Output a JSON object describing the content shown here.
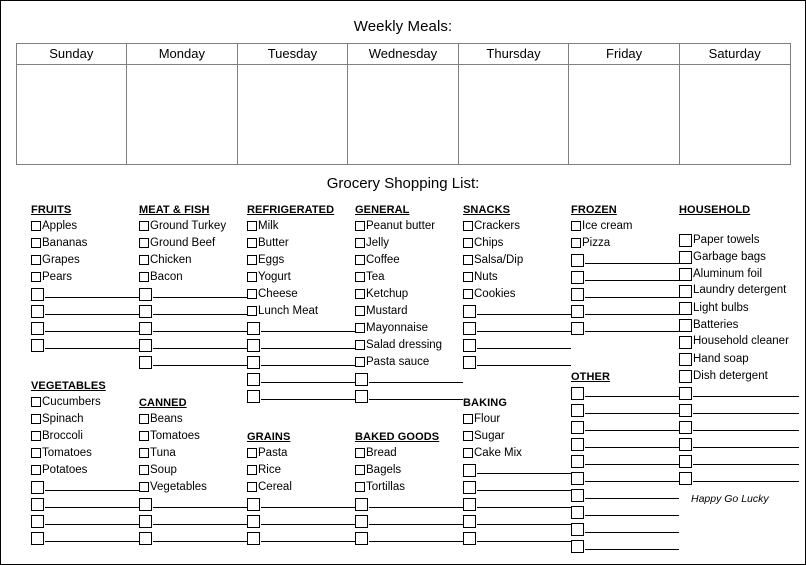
{
  "meals": {
    "title": "Weekly Meals:",
    "days": [
      "Sunday",
      "Monday",
      "Tuesday",
      "Wednesday",
      "Thursday",
      "Friday",
      "Saturday"
    ]
  },
  "grocery": {
    "title": "Grocery Shopping List:",
    "footer": "Happy Go Lucky",
    "columns": [
      {
        "name": "column-1",
        "sections": [
          {
            "name": "fruits",
            "heading": "FRUITS",
            "underline": true,
            "items": [
              "Apples",
              "Bananas",
              "Grapes",
              "Pears"
            ],
            "blanks": 4
          },
          {
            "name": "vegetables",
            "heading": "VEGETABLES",
            "underline": true,
            "items": [
              "Cucumbers",
              "Spinach",
              "Broccoli",
              "Tomatoes",
              "Potatoes"
            ],
            "blanks": 4
          }
        ]
      },
      {
        "name": "column-2",
        "sections": [
          {
            "name": "meat-and-fish",
            "heading": "MEAT & FISH",
            "underline": true,
            "items": [
              "Ground Turkey",
              "Ground Beef",
              "Chicken",
              "Bacon"
            ],
            "blanks": 5
          },
          {
            "name": "canned",
            "heading": "CANNED",
            "underline": true,
            "items": [
              "Beans",
              "Tomatoes",
              "Tuna",
              "Soup",
              "Vegetables"
            ],
            "blanks": 3
          }
        ]
      },
      {
        "name": "column-3",
        "sections": [
          {
            "name": "refrigerated",
            "heading": "REFRIGERATED",
            "underline": true,
            "items": [
              "Milk",
              "Butter",
              "Eggs",
              "Yogurt",
              "Cheese",
              "Lunch Meat"
            ],
            "blanks": 5
          },
          {
            "name": "grains",
            "heading": "GRAINS",
            "underline": true,
            "items": [
              "Pasta",
              "Rice",
              "Cereal"
            ],
            "blanks": 3
          }
        ]
      },
      {
        "name": "column-4",
        "sections": [
          {
            "name": "general",
            "heading": "GENERAL",
            "underline": true,
            "items": [
              "Peanut butter",
              "Jelly",
              "Coffee",
              "Tea",
              "Ketchup",
              "Mustard",
              "Mayonnaise",
              "Salad dressing",
              "Pasta sauce"
            ],
            "blanks": 2
          },
          {
            "name": "baked-goods",
            "heading": "BAKED GOODS",
            "underline": true,
            "items": [
              "Bread",
              "Bagels",
              "Tortillas"
            ],
            "blanks": 3
          }
        ]
      },
      {
        "name": "column-5",
        "sections": [
          {
            "name": "snacks",
            "heading": "SNACKS",
            "underline": true,
            "items": [
              "Crackers",
              "Chips",
              "Salsa/Dip",
              "Nuts",
              "Cookies"
            ],
            "blanks": 4
          },
          {
            "name": "baking",
            "heading": "BAKING",
            "underline": false,
            "items": [
              "Flour",
              "Sugar",
              "Cake Mix"
            ],
            "blanks": 5
          }
        ]
      },
      {
        "name": "column-6",
        "sections": [
          {
            "name": "frozen",
            "heading": "FROZEN",
            "underline": true,
            "items": [
              "Ice cream",
              "Pizza"
            ],
            "blanks": 5
          },
          {
            "name": "other",
            "heading": "OTHER",
            "underline": true,
            "items": [],
            "blanks": 10
          }
        ]
      },
      {
        "name": "column-7",
        "sections": [
          {
            "name": "household",
            "heading": "HOUSEHOLD",
            "underline": true,
            "items": [
              "Paper towels",
              "Garbage bags",
              "Aluminum foil",
              "Laundry detergent",
              "Light bulbs",
              "Batteries",
              "Household cleaner",
              "Hand soap",
              "Dish detergent"
            ],
            "blanks": 6
          }
        ]
      }
    ]
  }
}
